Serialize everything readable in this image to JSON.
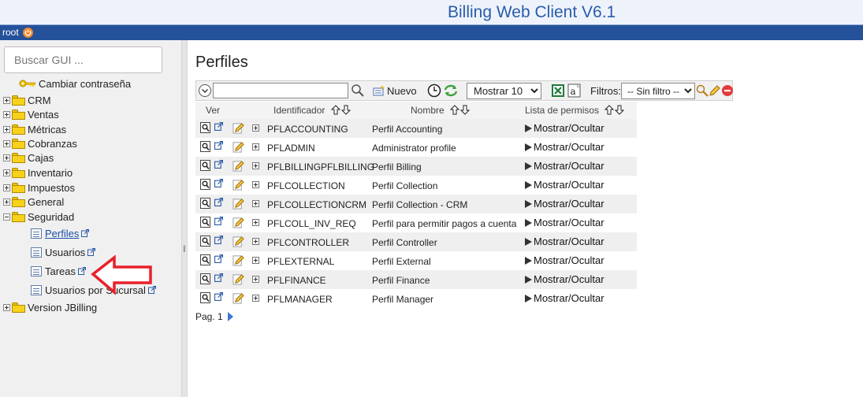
{
  "header": {
    "title": "Billing Web Client V6.1"
  },
  "userbar": {
    "user": "root"
  },
  "sidebar": {
    "search_placeholder": "Buscar GUI ...",
    "change_password": "Cambiar contraseña",
    "items": [
      {
        "label": "CRM",
        "expanded": false
      },
      {
        "label": "Ventas",
        "expanded": false
      },
      {
        "label": "Métricas",
        "expanded": false
      },
      {
        "label": "Cobranzas",
        "expanded": false
      },
      {
        "label": "Cajas",
        "expanded": false
      },
      {
        "label": "Inventario",
        "expanded": false
      },
      {
        "label": "Impuestos",
        "expanded": false
      },
      {
        "label": "General",
        "expanded": false
      },
      {
        "label": "Seguridad",
        "expanded": true
      },
      {
        "label": "Version JBilling",
        "expanded": false
      }
    ],
    "security_items": [
      {
        "label": "Perfiles",
        "active": true
      },
      {
        "label": "Usuarios",
        "active": false
      },
      {
        "label": "Tareas",
        "active": false
      },
      {
        "label": "Usuarios por Sucursal",
        "active": false
      }
    ]
  },
  "main": {
    "title": "Perfiles",
    "toolbar": {
      "search_value": "",
      "new_label": "Nuevo",
      "show_value": "Mostrar 10",
      "filters_label": "Filtros:",
      "filter_value": "-- Sin filtro --"
    },
    "columns": {
      "view": "Ver",
      "id": "Identificador",
      "name": "Nombre",
      "perms": "Lista de permisos"
    },
    "rows": [
      {
        "id": "PFLACCOUNTING",
        "name": "Perfil Accounting",
        "perms": "Mostrar/Ocultar"
      },
      {
        "id": "PFLADMIN",
        "name": "Administrator profile",
        "perms": "Mostrar/Ocultar"
      },
      {
        "id": "PFLBILLINGPFLBILLING",
        "name": "Perfil Billing",
        "perms": "Mostrar/Ocultar"
      },
      {
        "id": "PFLCOLLECTION",
        "name": "Perfil Collection",
        "perms": "Mostrar/Ocultar"
      },
      {
        "id": "PFLCOLLECTIONCRM",
        "name": "Perfil Collection - CRM",
        "perms": "Mostrar/Ocultar"
      },
      {
        "id": "PFLCOLL_INV_REQ",
        "name": "Perfil para permitir pagos a cuenta",
        "perms": "Mostrar/Ocultar"
      },
      {
        "id": "PFLCONTROLLER",
        "name": "Perfil Controller",
        "perms": "Mostrar/Ocultar"
      },
      {
        "id": "PFLEXTERNAL",
        "name": "Perfil External",
        "perms": "Mostrar/Ocultar"
      },
      {
        "id": "PFLFINANCE",
        "name": "Perfil Finance",
        "perms": "Mostrar/Ocultar"
      },
      {
        "id": "PFLMANAGER",
        "name": "Perfil Manager",
        "perms": "Mostrar/Ocultar"
      }
    ],
    "pager": {
      "label": "Pag. 1"
    }
  },
  "colors": {
    "header_bg": "#eef3fb",
    "title": "#2a5caa",
    "userbar": "#24519a",
    "link": "#1c4fa8",
    "arrow": "#e8202a"
  },
  "icons": [
    "power-icon",
    "key-icon",
    "folder-icon",
    "page-icon",
    "external-link-icon",
    "magnifier-icon",
    "new-icon",
    "clock-icon",
    "refresh-icon",
    "excel-icon",
    "pdf-icon",
    "edit-icon",
    "delete-icon",
    "view-icon",
    "expand-icon",
    "sort-icon",
    "next-page-icon"
  ]
}
